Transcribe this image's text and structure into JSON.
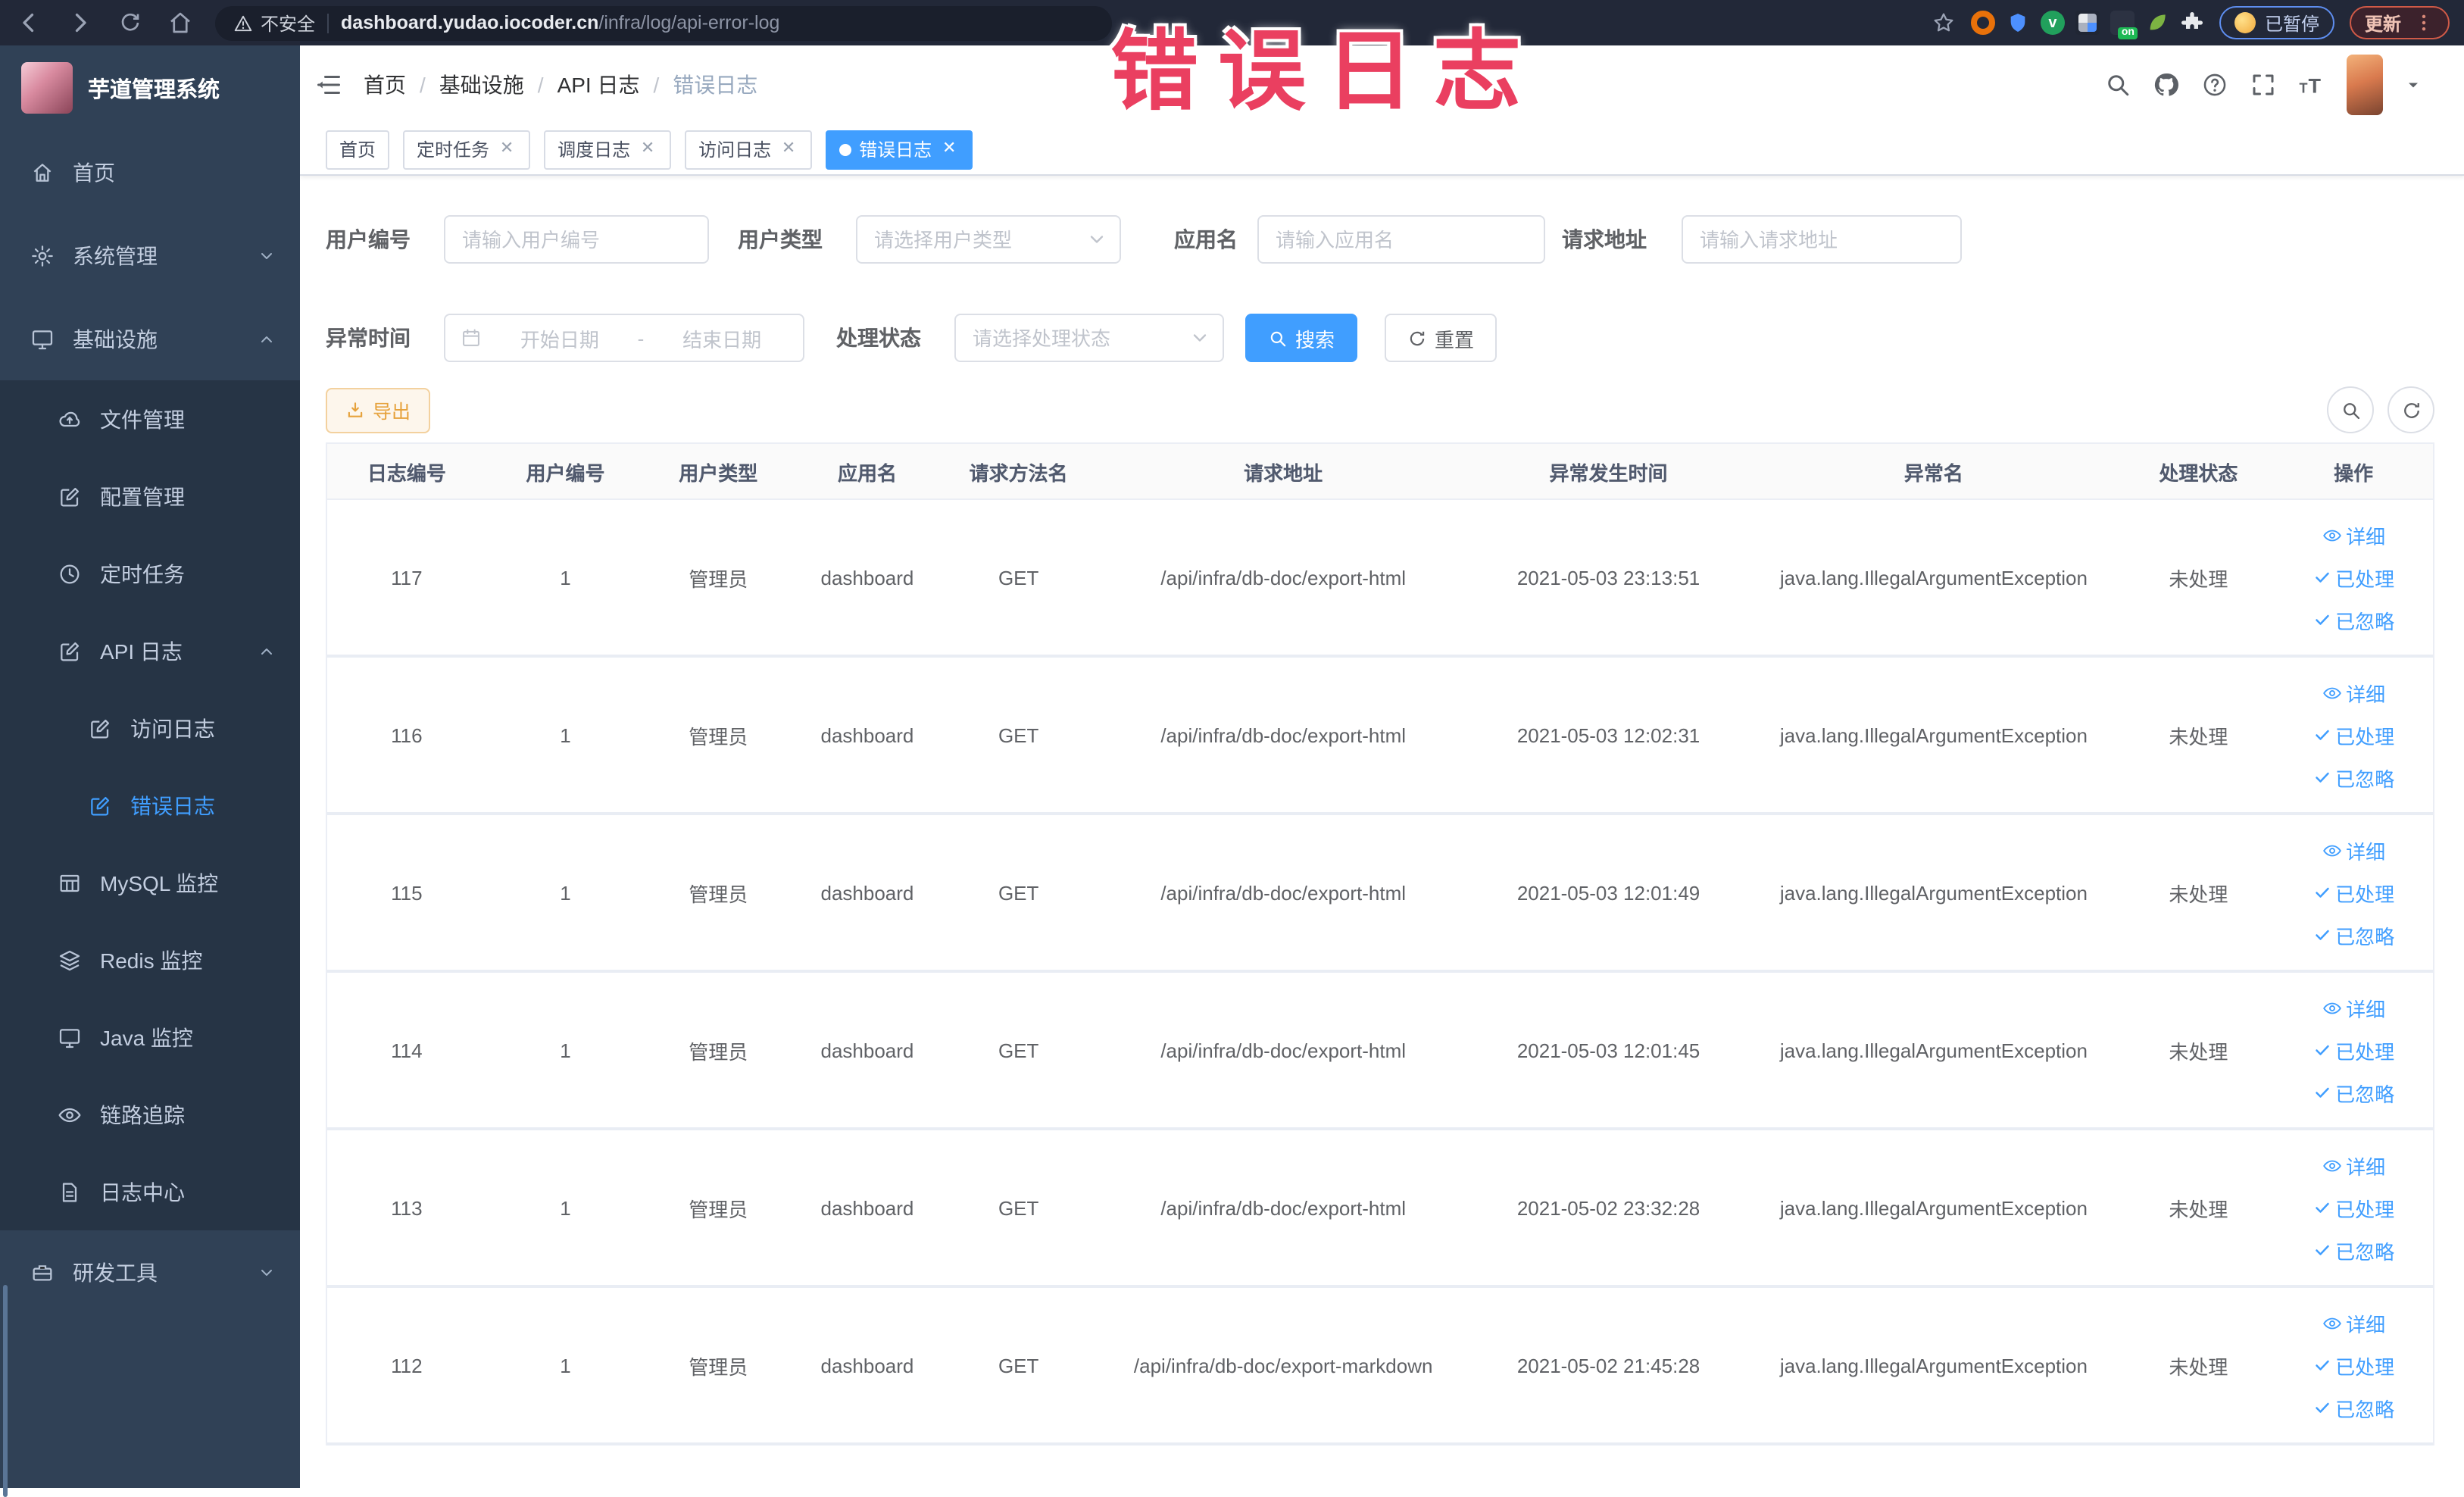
{
  "watermark": {
    "text": "错误日志"
  },
  "browser": {
    "security_label": "不安全",
    "url_domain": "dashboard.yudao.iocoder.cn",
    "url_path": "/infra/log/api-error-log",
    "paused_label": "已暂停",
    "update_label": "更新"
  },
  "sidebar": {
    "title": "芋道管理系统",
    "items": {
      "home": "首页",
      "system": "系统管理",
      "infra": "基础设施",
      "file": "文件管理",
      "config": "配置管理",
      "job": "定时任务",
      "api_log": "API 日志",
      "access_log": "访问日志",
      "error_log": "错误日志",
      "mysql": "MySQL 监控",
      "redis": "Redis 监控",
      "java": "Java 监控",
      "trace": "链路追踪",
      "log_center": "日志中心",
      "dev_tools": "研发工具"
    }
  },
  "header": {
    "breadcrumb": {
      "home": "首页",
      "sep": "/",
      "infra": "基础设施",
      "api_log": "API 日志",
      "current": "错误日志"
    }
  },
  "tabs": {
    "home": "首页",
    "job": "定时任务",
    "job_log": "调度日志",
    "access_log": "访问日志",
    "error_log": "错误日志"
  },
  "filters": {
    "user_id_label": "用户编号",
    "user_id_placeholder": "请输入用户编号",
    "user_type_label": "用户类型",
    "user_type_placeholder": "请选择用户类型",
    "app_name_label": "应用名",
    "app_name_placeholder": "请输入应用名",
    "request_url_label": "请求地址",
    "request_url_placeholder": "请输入请求地址",
    "exception_time_label": "异常时间",
    "start_date_placeholder": "开始日期",
    "range_separator": "-",
    "end_date_placeholder": "结束日期",
    "process_status_label": "处理状态",
    "process_status_placeholder": "请选择处理状态",
    "search_label": "搜索",
    "reset_label": "重置"
  },
  "toolbar": {
    "export_label": "导出"
  },
  "table": {
    "columns": [
      "日志编号",
      "用户编号",
      "用户类型",
      "应用名",
      "请求方法名",
      "请求地址",
      "异常发生时间",
      "异常名",
      "处理状态",
      "操作"
    ],
    "actions": {
      "detail": "详细",
      "processed": "已处理",
      "ignored": "已忽略"
    },
    "rows": [
      {
        "id": "117",
        "user_id": "1",
        "user_type": "管理员",
        "app": "dashboard",
        "method": "GET",
        "url": "/api/infra/db-doc/export-html",
        "time": "2021-05-03 23:13:51",
        "exception": "java.lang.IllegalArgumentException",
        "status": "未处理"
      },
      {
        "id": "116",
        "user_id": "1",
        "user_type": "管理员",
        "app": "dashboard",
        "method": "GET",
        "url": "/api/infra/db-doc/export-html",
        "time": "2021-05-03 12:02:31",
        "exception": "java.lang.IllegalArgumentException",
        "status": "未处理"
      },
      {
        "id": "115",
        "user_id": "1",
        "user_type": "管理员",
        "app": "dashboard",
        "method": "GET",
        "url": "/api/infra/db-doc/export-html",
        "time": "2021-05-03 12:01:49",
        "exception": "java.lang.IllegalArgumentException",
        "status": "未处理"
      },
      {
        "id": "114",
        "user_id": "1",
        "user_type": "管理员",
        "app": "dashboard",
        "method": "GET",
        "url": "/api/infra/db-doc/export-html",
        "time": "2021-05-03 12:01:45",
        "exception": "java.lang.IllegalArgumentException",
        "status": "未处理"
      },
      {
        "id": "113",
        "user_id": "1",
        "user_type": "管理员",
        "app": "dashboard",
        "method": "GET",
        "url": "/api/infra/db-doc/export-html",
        "time": "2021-05-02 23:32:28",
        "exception": "java.lang.IllegalArgumentException",
        "status": "未处理"
      },
      {
        "id": "112",
        "user_id": "1",
        "user_type": "管理员",
        "app": "dashboard",
        "method": "GET",
        "url": "/api/infra/db-doc/export-markdown",
        "time": "2021-05-02 21:45:28",
        "exception": "java.lang.IllegalArgumentException",
        "status": "未处理"
      }
    ]
  },
  "colors": {
    "accent": "#409eff",
    "warning": "#e6a23c",
    "sidebar": "#304156",
    "sidebar_sub": "#263445",
    "watermark": "#ea3f60"
  }
}
